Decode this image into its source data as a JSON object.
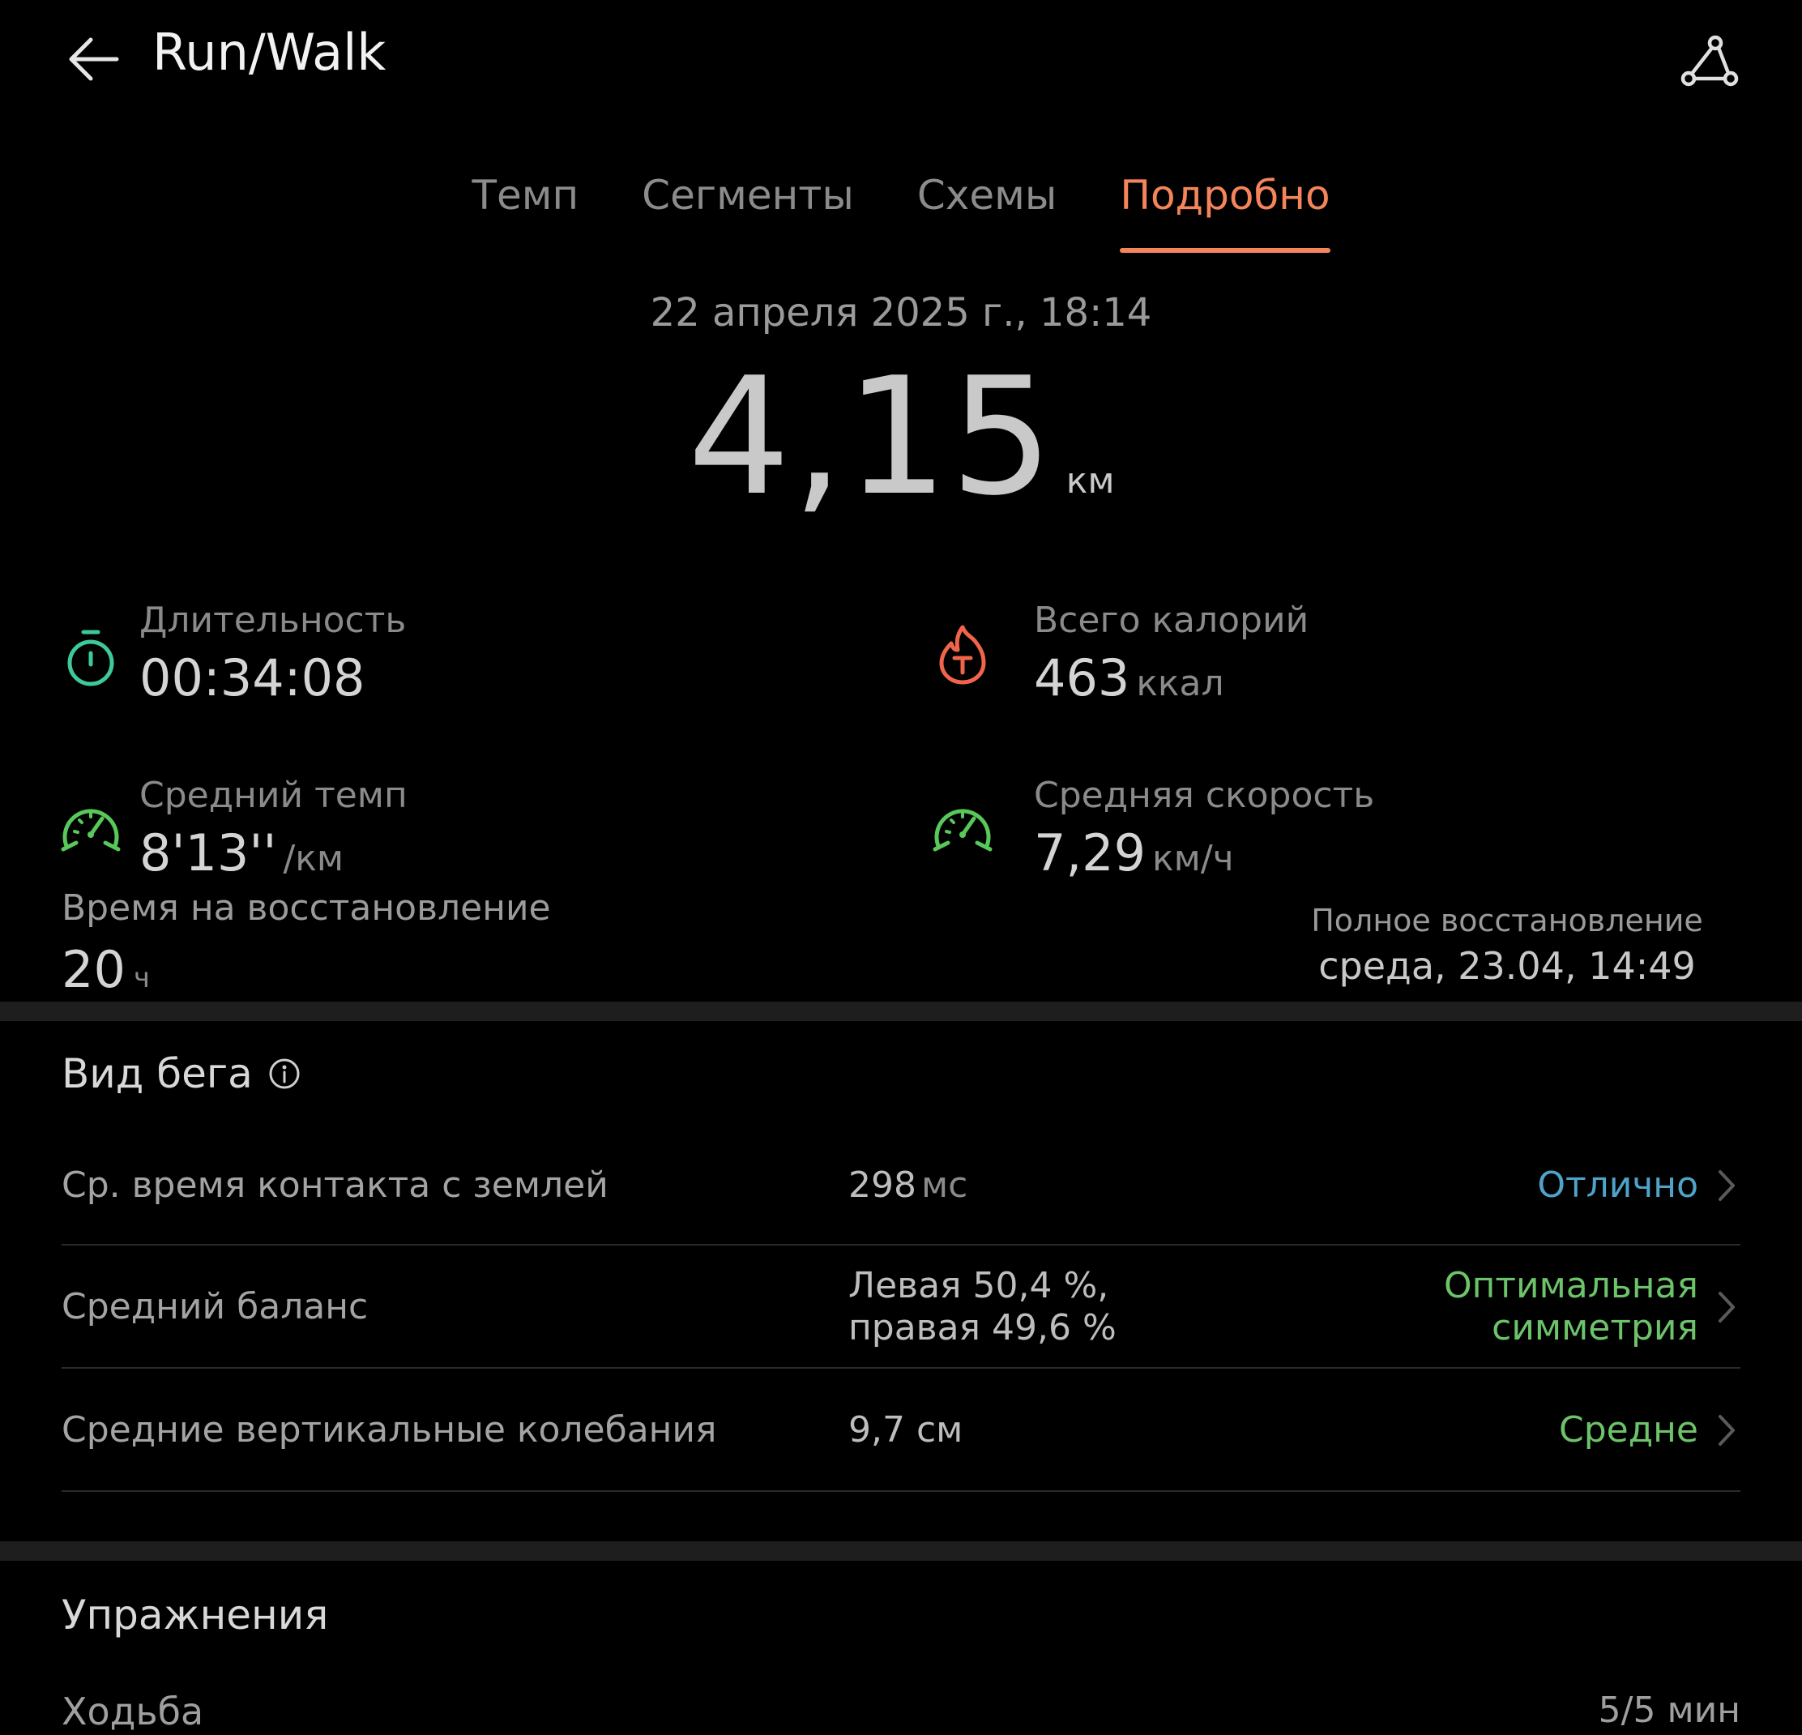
{
  "header": {
    "title": "Run/Walk",
    "back_icon": "arrow-left-icon",
    "route_icon": "route-share-icon"
  },
  "tabs": [
    {
      "label": "Темп",
      "active": false
    },
    {
      "label": "Сегменты",
      "active": false
    },
    {
      "label": "Схемы",
      "active": false
    },
    {
      "label": "Подробно",
      "active": true
    }
  ],
  "workout": {
    "date": "22 апреля 2025 г., 18:14",
    "distance_value": "4,15",
    "distance_unit": "км"
  },
  "stats": {
    "duration": {
      "label": "Длительность",
      "value": "00:34:08",
      "unit": "",
      "icon": "stopwatch-icon",
      "color": "#3ec99b"
    },
    "calories": {
      "label": "Всего калорий",
      "value": "463",
      "unit": "ккал",
      "icon": "flame-icon",
      "color": "#f0644a"
    },
    "pace": {
      "label": "Средний темп",
      "value": "8'13''",
      "unit": "/км",
      "icon": "speedometer-icon",
      "color": "#58c85a"
    },
    "speed": {
      "label": "Средняя скорость",
      "value": "7,29",
      "unit": "км/ч",
      "icon": "speedometer-icon",
      "color": "#58c85a"
    }
  },
  "recovery": {
    "label": "Время на восстановление",
    "value": "20",
    "unit": "ч",
    "full_label": "Полное восстановление",
    "full_value": "среда, 23.04, 14:49"
  },
  "running_form": {
    "title": "Вид бега",
    "info_icon": "info-icon",
    "rows": [
      {
        "label": "Ср. время контакта с землей",
        "value": "298",
        "unit": "мс",
        "rating": "Отлично",
        "rating_color": "#4ea3c9"
      },
      {
        "label": "Средний баланс",
        "value": "Левая 50,4 %, правая 49,6 %",
        "unit": "",
        "rating": "Оптимальная симметрия",
        "rating_color": "#6cc36a"
      },
      {
        "label": "Средние вертикальные колебания",
        "value": "9,7 см",
        "unit": "",
        "rating": "Средне",
        "rating_color": "#6cc36a"
      }
    ]
  },
  "exercises": {
    "title": "Упражнения",
    "rows": [
      {
        "label": "Ходьба",
        "value": "5/5 мин"
      }
    ]
  },
  "colors": {
    "background": "#000000",
    "accent": "#f4855a",
    "divider": "#1e1e1e"
  }
}
